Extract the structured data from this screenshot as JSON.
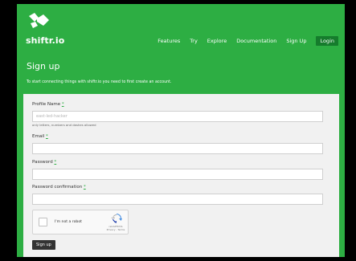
{
  "header": {
    "brand": "shiftr.io",
    "logo_icon": "shiftr-logo-icon",
    "nav": [
      "Features",
      "Try",
      "Explore",
      "Documentation",
      "Sign Up"
    ],
    "login": "Login"
  },
  "page": {
    "title": "Sign up",
    "intro": "To start connecting things with shiftr.io you need to first create an account."
  },
  "form": {
    "profile_name_label": "Profile Name",
    "profile_name_placeholder": "east-led-hacker",
    "profile_name_hint": "only letters, numbers and dashes allowed",
    "email_label": "Email",
    "password_label": "Password",
    "password_confirmation_label": "Password confirmation",
    "required_marker": "*",
    "captcha_text": "I'm not a robot",
    "captcha_brand": "reCAPTCHA",
    "captcha_links": "Privacy - Terms",
    "submit_label": "Sign up"
  },
  "colors": {
    "accent": "#2dae43",
    "login_bg": "#157c2c",
    "card_bg": "#f1f1f1",
    "button_bg": "#333333"
  }
}
